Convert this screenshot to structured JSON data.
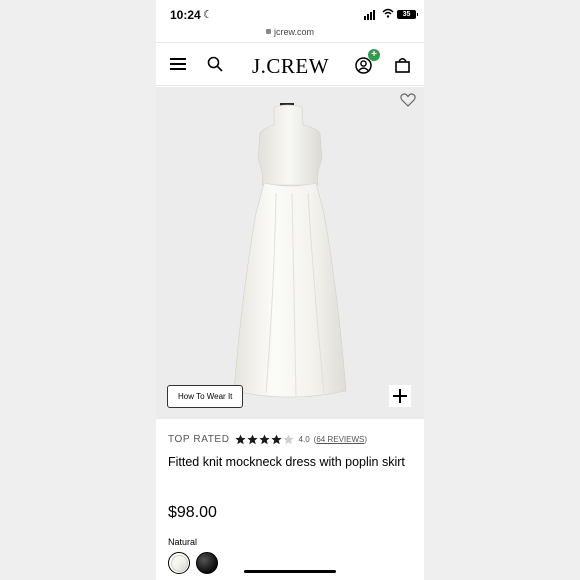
{
  "status": {
    "time": "10:24",
    "battery": "35",
    "url": "jcrew.com"
  },
  "nav": {
    "brand": "J.CREW",
    "account_badge": "+"
  },
  "product": {
    "image_button": "How To Wear It",
    "badge": "TOP RATED",
    "rating": "4.0",
    "rating_stars": 4,
    "reviews_prefix": "(",
    "reviews_link": "64 REVIEWS",
    "reviews_suffix": ")",
    "name": "Fitted knit mockneck dress with poplin skirt",
    "price": "$98.00",
    "color_label": "Natural",
    "swatches": [
      "natural",
      "black"
    ]
  },
  "colors": {
    "accent_green": "#2e9c4a",
    "image_bg": "#ececec"
  }
}
